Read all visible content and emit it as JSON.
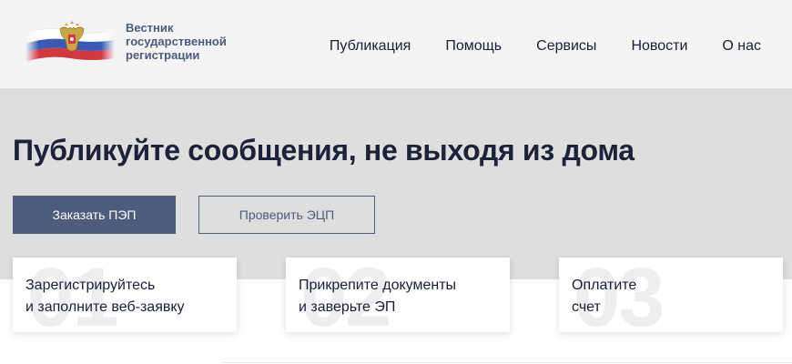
{
  "header": {
    "logo_lines": [
      "Вестник",
      "государственной",
      "регистрации"
    ],
    "nav": [
      "Публикация",
      "Помощь",
      "Сервисы",
      "Новости",
      "О нас"
    ]
  },
  "hero": {
    "title": "Публикуйте сообщения, не выходя из дома",
    "primary_button": "Заказать ПЭП",
    "secondary_button": "Проверить ЭЦП"
  },
  "steps": [
    {
      "number": "01",
      "lines": [
        "Зарегистрируйтесь",
        "и заполните веб-заявку"
      ]
    },
    {
      "number": "02",
      "lines": [
        "Прикрепите документы",
        "и заверьте ЭП"
      ]
    },
    {
      "number": "03",
      "lines": [
        "Оплатите",
        "счет"
      ]
    }
  ],
  "colors": {
    "accent": "#4d5b7c",
    "header_bg": "#f4f4f4",
    "hero_bg": "#dedede",
    "flag_white": "#ffffff",
    "flag_blue": "#3a5bb5",
    "flag_red": "#d4383f"
  }
}
